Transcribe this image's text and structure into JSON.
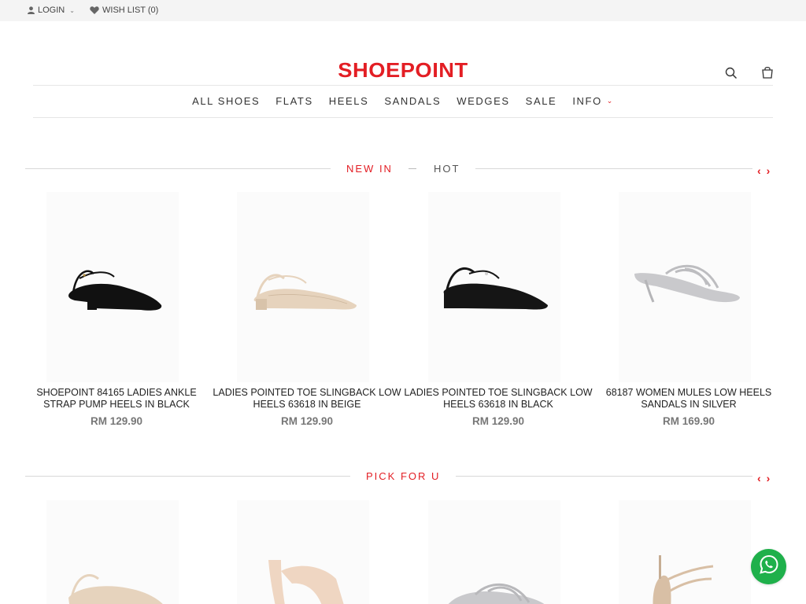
{
  "topbar": {
    "login_label": "LOGIN",
    "wishlist_label": "WISH LIST (0)"
  },
  "brand": {
    "logo_text": "SHOEPOINT",
    "color": "#e31e24"
  },
  "nav": {
    "items": [
      "ALL SHOES",
      "FLATS",
      "HEELS",
      "SANDALS",
      "WEDGES",
      "SALE",
      "INFO"
    ]
  },
  "section1": {
    "tabs": [
      "NEW IN",
      "HOT"
    ],
    "products": [
      {
        "name": "SHOEPOINT 84165 LADIES ANKLE STRAP PUMP HEELS IN BLACK",
        "price": "RM 129.90",
        "shoe_style": "block-heel-ankle-strap",
        "color": "#111111"
      },
      {
        "name": "LADIES POINTED TOE SLINGBACK LOW HEELS 63618 IN BEIGE",
        "price": "RM 129.90",
        "shoe_style": "slingback",
        "color": "#e6d3bd"
      },
      {
        "name": "LADIES POINTED TOE SLINGBACK LOW HEELS 63618 IN BLACK",
        "price": "RM 129.90",
        "shoe_style": "slingback",
        "color": "#151515"
      },
      {
        "name": "68187 WOMEN MULES LOW HEELS SANDALS IN SILVER",
        "price": "RM 169.90",
        "shoe_style": "mule",
        "color": "#c9c9cc"
      }
    ]
  },
  "section2": {
    "title": "PICK FOR U",
    "products": [
      {
        "shoe_style": "slingback",
        "color": "#e6d3bd"
      },
      {
        "shoe_style": "high-heel-sandal",
        "color": "#efd6c2"
      },
      {
        "shoe_style": "mule",
        "color": "#c9c9cc"
      },
      {
        "shoe_style": "strappy-heel",
        "color": "#d8bfa5"
      }
    ]
  },
  "icons": {
    "user": "user-icon",
    "heart": "heart-icon",
    "search": "search-icon",
    "bag": "shopping-bag-icon",
    "whatsapp": "whatsapp-icon"
  }
}
